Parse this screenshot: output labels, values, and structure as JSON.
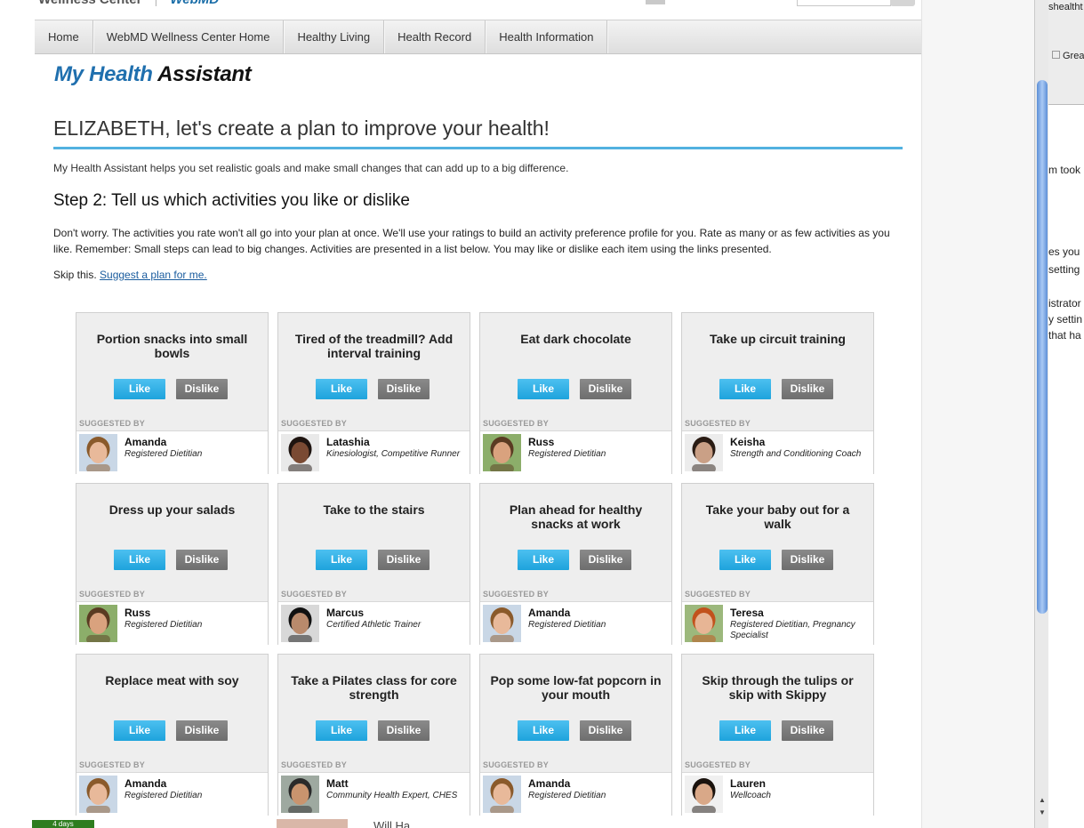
{
  "header": {
    "top_left_text": "Wellness Center",
    "top_brand": "WebMD"
  },
  "nav": {
    "items": [
      "Home",
      "WebMD Wellness Center Home",
      "Healthy Living",
      "Health Record",
      "Health Information"
    ]
  },
  "app_title": {
    "part1": "My Health",
    "part2": "Assistant"
  },
  "headline": "ELIZABETH, let's create a plan to improve your health!",
  "intro": "My Health Assistant helps you set realistic goals and make small changes that can add up to a big difference.",
  "step_title": "Step 2: Tell us which activities you like or dislike",
  "instructions": "Don't worry. The activities you rate won't all go into your plan at once. We'll use your ratings to build an activity preference profile for you. Rate as many or as few activities as you like. Remember: Small steps can lead to big changes. Activities are presented in a list below. You may like or dislike each item using the links presented.",
  "skip": {
    "prefix": "Skip this.",
    "link": "Suggest a plan for me."
  },
  "labels": {
    "like": "Like",
    "dislike": "Dislike",
    "suggested_by": "SUGGESTED BY"
  },
  "activities": [
    {
      "title": "Portion snacks into small bowls",
      "name": "Amanda",
      "role": "Registered Dietitian"
    },
    {
      "title": "Tired of the treadmill? Add interval training",
      "name": "Latashia",
      "role": "Kinesiologist, Competitive Runner"
    },
    {
      "title": "Eat dark chocolate",
      "name": "Russ",
      "role": "Registered Dietitian"
    },
    {
      "title": "Take up circuit training",
      "name": "Keisha",
      "role": "Strength and Conditioning Coach"
    },
    {
      "title": "Dress up your salads",
      "name": "Russ",
      "role": "Registered Dietitian"
    },
    {
      "title": "Take to the stairs",
      "name": "Marcus",
      "role": "Certified Athletic Trainer"
    },
    {
      "title": "Plan ahead for healthy snacks at work",
      "name": "Amanda",
      "role": "Registered Dietitian"
    },
    {
      "title": "Take your baby out for a walk",
      "name": "Teresa",
      "role": "Registered Dietitian, Pregnancy Specialist"
    },
    {
      "title": "Replace meat with soy",
      "name": "Amanda",
      "role": "Registered Dietitian"
    },
    {
      "title": "Take a Pilates class for core strength",
      "name": "Matt",
      "role": "Community Health Expert, CHES"
    },
    {
      "title": "Pop some low-fat popcorn in your mouth",
      "name": "Amanda",
      "role": "Registered Dietitian"
    },
    {
      "title": "Skip through the tulips or skip with Skippy",
      "name": "Lauren",
      "role": "Wellcoach"
    }
  ],
  "bottom": {
    "badge": "4 days",
    "text": "Will Ha"
  },
  "right_pane": {
    "lines": [
      "shealtht",
      "Grea",
      "m took",
      "es you",
      "setting",
      "istrator",
      "y settin",
      "that ha"
    ]
  },
  "colors": {
    "accent": "#52b1e0",
    "like": "#1ea3dc",
    "dislike": "#707070",
    "title_blue": "#1f6fae"
  }
}
